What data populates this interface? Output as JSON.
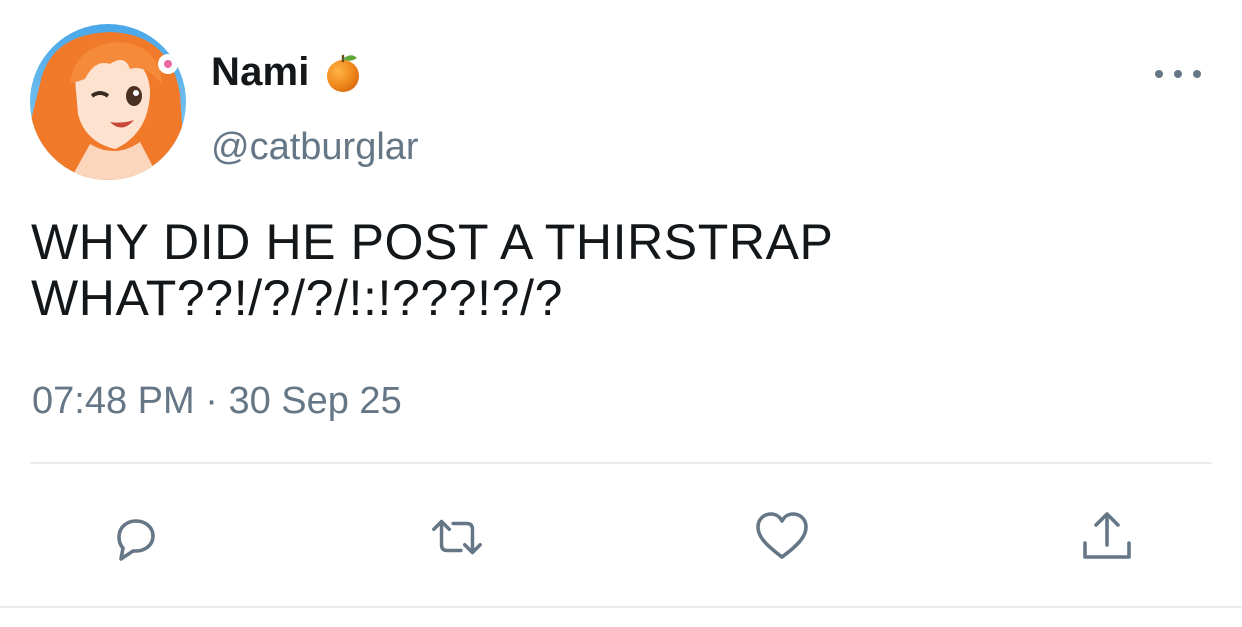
{
  "tweet": {
    "display_name": "Nami",
    "name_emoji": "orange-emoji",
    "handle": "@catburglar",
    "text": "WHY DID HE POST A THIRSTRAP\nWHAT??!/?/?/!:!???!?/?",
    "time": "07:48 PM",
    "separator": "·",
    "date": "30 Sep 25"
  },
  "actions": [
    {
      "icon": "reply-icon"
    },
    {
      "icon": "retweet-icon"
    },
    {
      "icon": "like-icon"
    },
    {
      "icon": "share-icon"
    }
  ],
  "colors": {
    "text": "#14171a",
    "secondary": "#657786",
    "divider": "#e6ecf0",
    "icon": "#657786"
  }
}
